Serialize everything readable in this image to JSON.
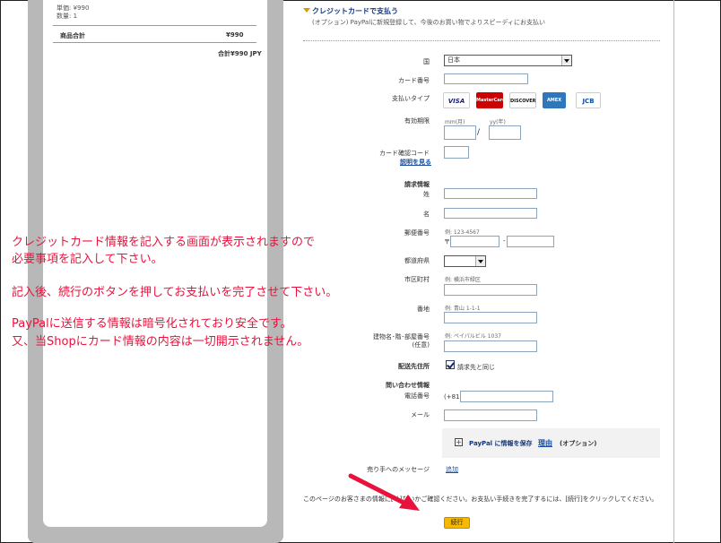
{
  "cart": {
    "unit_price": "単価: ¥990",
    "quantity": "数量: 1",
    "subtotal_label": "商品合計",
    "subtotal_value": "¥990",
    "total": "合計¥990 JPY"
  },
  "section": {
    "title": "クレジットカードで支払う",
    "subtitle": "(オプション) PayPalに新規登録して、今後のお買い物でよりスピーディにお支払い"
  },
  "form": {
    "country_label": "国",
    "country_value": "日本",
    "card_number_label": "カード番号",
    "payment_type_label": "支払いタイプ",
    "cards": [
      "VISA",
      "MasterCard",
      "DISCOVER",
      "AMEX",
      "JCB"
    ],
    "expiry_label": "有効期限",
    "expiry_month_hint": "mm(月)",
    "expiry_year_hint": "yy(年)",
    "expiry_separator": "/",
    "cvv_label": "カード確認コード",
    "cvv_help_link": "説明を見る",
    "billing_heading": "請求情報",
    "last_name_label": "姓",
    "first_name_label": "名",
    "postal_label": "郵便番号",
    "postal_hint": "例: 123-4567",
    "postal_prefix": "〒",
    "postal_dash": "-",
    "prefecture_label": "都道府県",
    "city_label": "市区町村",
    "city_hint": "例: 横浜市緑区",
    "address_label": "番地",
    "address_hint": "例: 青山 1-1-1",
    "building_label": "建物名･階･部屋番号",
    "building_optional": "(任意)",
    "building_hint": "例: ペイパルビル 1037",
    "shipping_label": "配送先住所",
    "shipping_same": "請求先と同じ",
    "contact_heading": "問い合わせ情報",
    "phone_label": "電話番号",
    "phone_prefix": "(+81)",
    "email_label": "メール",
    "save_text": "PayPal に情報を保存",
    "save_reason": "理由",
    "save_optional": "(オプション)",
    "seller_message_label": "売り手へのメッセージ",
    "seller_message_link": "追加",
    "confirm_note": "このページのお客さまの情報に[Ｘ]ないかご確認ください。お支払い手続きを完了するには、[続行]をクリックしてください。",
    "continue_button": "続行"
  },
  "annotation": {
    "line1": "クレジットカード情報を記入する画面が表示されますので",
    "line2": "必要事項を記入して下さい。",
    "line3": "記入後、続行のボタンを押してお支払いを完了させて下さい。",
    "line4": "PayPalに送信する情報は暗号化されており安全です。",
    "line5": "又、当Shopにカード情報の内容は一切開示されません。"
  },
  "colors": {
    "annotation_text": "#e8123c",
    "arrow": "#e8123c",
    "button": "#f7b900",
    "link": "#1a4fa0"
  }
}
